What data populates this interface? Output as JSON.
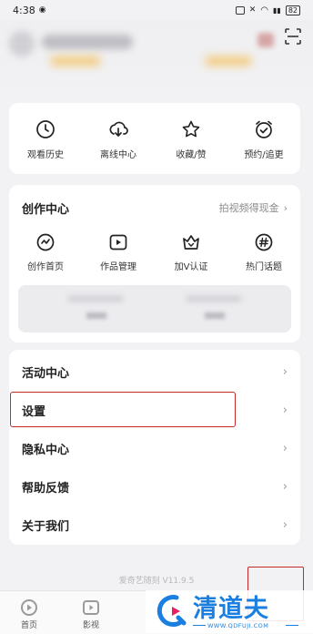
{
  "status": {
    "time": "4:38",
    "battery": "82"
  },
  "quick_actions": [
    {
      "label": "观看历史",
      "icon": "clock-icon"
    },
    {
      "label": "离线中心",
      "icon": "download-icon"
    },
    {
      "label": "收藏/赞",
      "icon": "star-icon"
    },
    {
      "label": "预约/追更",
      "icon": "alarm-icon"
    }
  ],
  "creation": {
    "title": "创作中心",
    "more": "拍视频得现金",
    "items": [
      {
        "label": "创作首页",
        "icon": "creator-home-icon"
      },
      {
        "label": "作品管理",
        "icon": "video-manage-icon"
      },
      {
        "label": "加V认证",
        "icon": "crown-icon"
      },
      {
        "label": "热门话题",
        "icon": "hashtag-icon"
      }
    ]
  },
  "menu": {
    "activity": "活动中心",
    "settings": "设置",
    "privacy": "隐私中心",
    "feedback": "帮助反馈",
    "about": "关于我们"
  },
  "version": "爱奇艺随刻 V11.9.5",
  "tabs": {
    "home": "首页",
    "video": "影视"
  },
  "watermark": {
    "brand": "清道夫",
    "url": "WWW.QDFUJI.COM"
  },
  "colors": {
    "highlight": "#c62828",
    "watermark": "#1a7fe0"
  }
}
